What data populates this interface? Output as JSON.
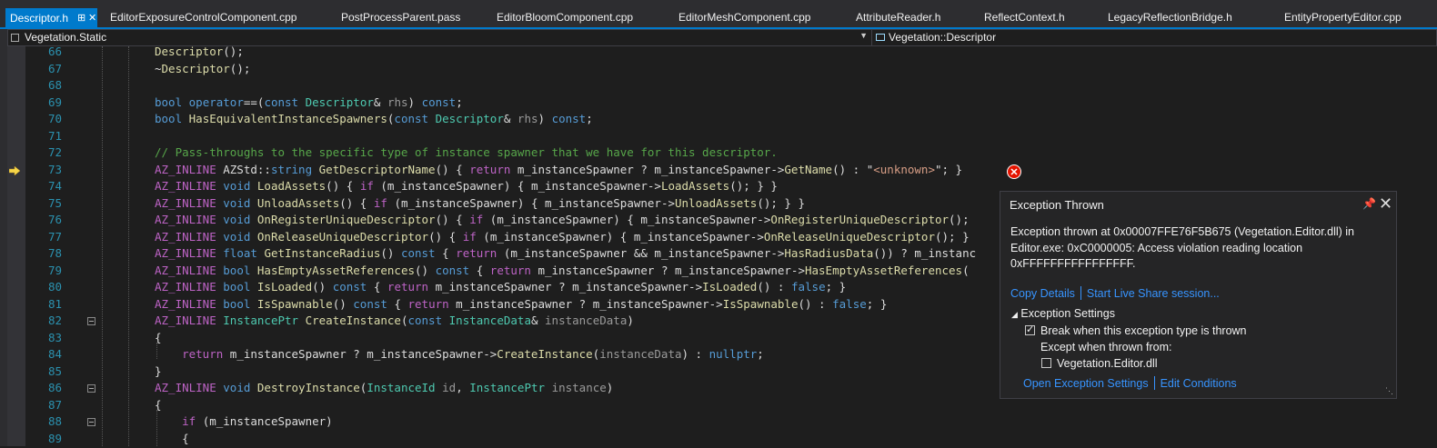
{
  "tabs": [
    {
      "label": "Descriptor.h",
      "active": true
    },
    {
      "label": "EditorExposureControlComponent.cpp"
    },
    {
      "label": "PostProcessParent.pass"
    },
    {
      "label": "EditorBloomComponent.cpp"
    },
    {
      "label": "EditorMeshComponent.cpp"
    },
    {
      "label": "AttributeReader.h"
    },
    {
      "label": "ReflectContext.h"
    },
    {
      "label": "LegacyReflectionBridge.h"
    },
    {
      "label": "EntityPropertyEditor.cpp"
    }
  ],
  "nav": {
    "scope": "Vegetation.Static",
    "member": "Vegetation::Descriptor"
  },
  "line_numbers": [
    "66",
    "67",
    "68",
    "69",
    "70",
    "71",
    "72",
    "73",
    "74",
    "75",
    "76",
    "77",
    "78",
    "79",
    "80",
    "81",
    "82",
    "83",
    "84",
    "85",
    "86",
    "87",
    "88",
    "89"
  ],
  "exception": {
    "title": "Exception Thrown",
    "message": "Exception thrown at 0x00007FFE76F5B675 (Vegetation.Editor.dll) in Editor.exe: 0xC0000005: Access violation reading location 0xFFFFFFFFFFFFFFFF.",
    "copy_details": "Copy Details",
    "live_share": "Start Live Share session...",
    "settings_header": "Exception Settings",
    "break_label": "Break when this exception type is thrown",
    "break_checked": true,
    "except_label": "Except when thrown from:",
    "module_label": "Vegetation.Editor.dll",
    "module_checked": false,
    "open_settings": "Open Exception Settings",
    "edit_conditions": "Edit Conditions"
  },
  "colors": {
    "accent": "#007acc",
    "error": "#e51400",
    "link": "#3794ff"
  }
}
